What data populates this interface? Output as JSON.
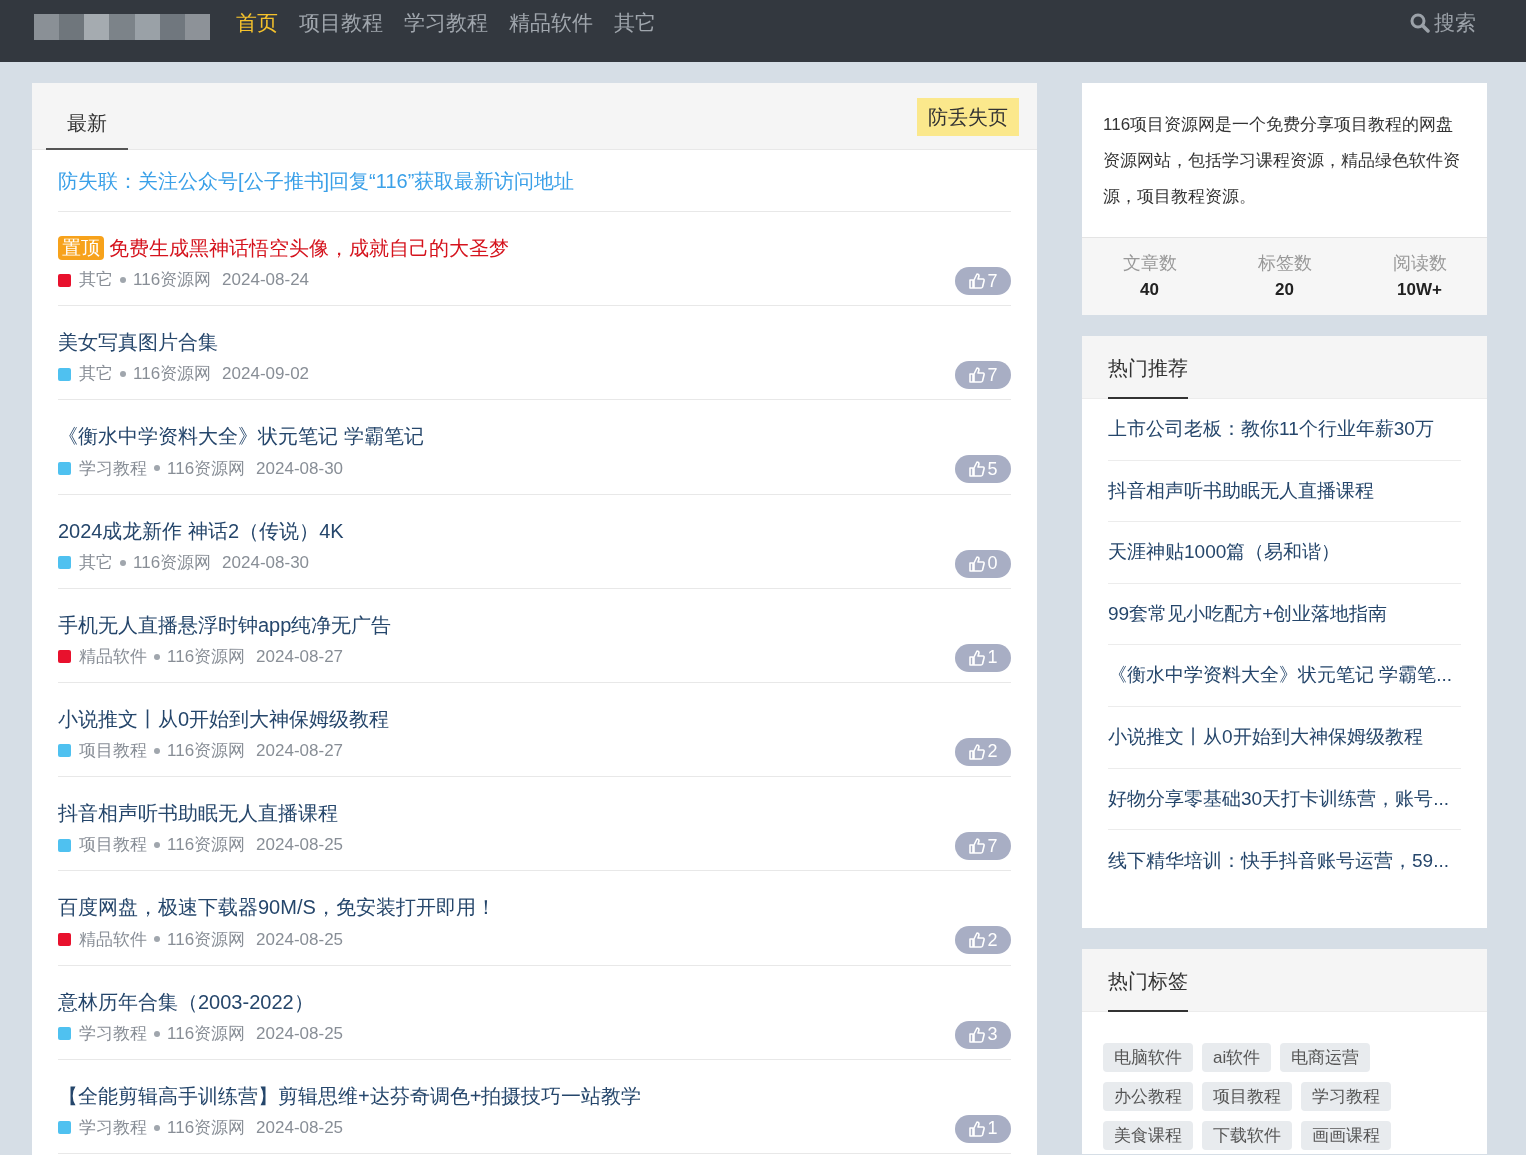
{
  "nav": {
    "items": [
      {
        "label": "首页",
        "selected": true
      },
      {
        "label": "项目教程",
        "selected": false
      },
      {
        "label": "学习教程",
        "selected": false
      },
      {
        "label": "精品软件",
        "selected": false
      },
      {
        "label": "其它",
        "selected": false
      }
    ],
    "search": "搜索"
  },
  "main": {
    "tabs": [
      {
        "label": "最新",
        "selected": true
      }
    ],
    "bookmark_button": "防丢失页",
    "notice": "防失联：关注公众号[公子推书]回复“116”获取最新访问地址",
    "articles": [
      {
        "badge": "置顶",
        "title": "免费生成黑神话悟空头像，成就自己的大圣梦",
        "pinned": true,
        "category": "其它",
        "color": "#e8112d",
        "source": "116资源网",
        "date": "2024-08-24",
        "likes": "7"
      },
      {
        "title": "美女写真图片合集",
        "pinned": false,
        "category": "其它",
        "color": "#4fc1f0",
        "source": "116资源网",
        "date": "2024-09-02",
        "likes": "7"
      },
      {
        "title": "《衡水中学资料大全》状元笔记 学霸笔记",
        "pinned": false,
        "category": "学习教程",
        "color": "#4fc1f0",
        "source": "116资源网",
        "date": "2024-08-30",
        "likes": "5"
      },
      {
        "title": "2024成龙新作 神话2（传说）4K",
        "pinned": false,
        "category": "其它",
        "color": "#4fc1f0",
        "source": "116资源网",
        "date": "2024-08-30",
        "likes": "0"
      },
      {
        "title": "手机无人直播悬浮时钟app纯净无广告",
        "pinned": false,
        "category": "精品软件",
        "color": "#e8112d",
        "source": "116资源网",
        "date": "2024-08-27",
        "likes": "1"
      },
      {
        "title": "小说推文丨从0开始到大神保姆级教程",
        "pinned": false,
        "category": "项目教程",
        "color": "#4fc1f0",
        "source": "116资源网",
        "date": "2024-08-27",
        "likes": "2"
      },
      {
        "title": "抖音相声听书助眠无人直播课程",
        "pinned": false,
        "category": "项目教程",
        "color": "#4fc1f0",
        "source": "116资源网",
        "date": "2024-08-25",
        "likes": "7"
      },
      {
        "title": "百度网盘，极速下载器90M/S，免安装打开即用！",
        "pinned": false,
        "category": "精品软件",
        "color": "#e8112d",
        "source": "116资源网",
        "date": "2024-08-25",
        "likes": "2"
      },
      {
        "title": "意林历年合集（2003-2022）",
        "pinned": false,
        "category": "学习教程",
        "color": "#4fc1f0",
        "source": "116资源网",
        "date": "2024-08-25",
        "likes": "3"
      },
      {
        "title": "【全能剪辑高手训练营】剪辑思维+达芬奇调色+拍摄技巧一站教学",
        "pinned": false,
        "category": "学习教程",
        "color": "#4fc1f0",
        "source": "116资源网",
        "date": "2024-08-25",
        "likes": "1"
      }
    ]
  },
  "sidebar": {
    "about": "116项目资源网是一个免费分享项目教程的网盘资源网站，包括学习课程资源，精品绿色软件资源，项目教程资源。",
    "stats": [
      {
        "label": "文章数",
        "value": "40"
      },
      {
        "label": "标签数",
        "value": "20"
      },
      {
        "label": "阅读数",
        "value": "10W+"
      }
    ],
    "hot": {
      "title": "热门推荐",
      "items": [
        "上市公司老板：教你11个行业年薪30万",
        "抖音相声听书助眠无人直播课程",
        "天涯神贴1000篇（易和谐）",
        "99套常见小吃配方+创业落地指南",
        "《衡水中学资料大全》状元笔记 学霸笔...",
        "小说推文丨从0开始到大神保姆级教程",
        "好物分享零基础30天打卡训练营，账号...",
        "线下精华培训：快手抖音账号运营，59..."
      ]
    },
    "tags": {
      "title": "热门标签",
      "items": [
        "电脑软件",
        "ai软件",
        "电商运营",
        "办公教程",
        "项目教程",
        "学习教程",
        "美食课程",
        "下载软件",
        "画画课程"
      ]
    }
  }
}
